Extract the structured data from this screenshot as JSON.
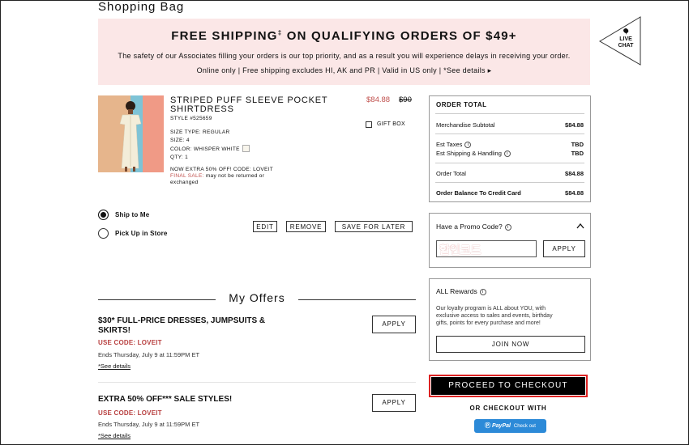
{
  "page": {
    "title": "Shopping Bag"
  },
  "banner": {
    "headline": "FREE SHIPPING",
    "mark": "‡",
    "headline_rest": " ON QUALIFYING ORDERS OF $49+",
    "line1": "The safety of our Associates filling your orders is our top priority, and as a result you will experience delays in receiving your order.",
    "line2": "Online only | Free shipping excludes HI, AK and PR | Valid in US only | *See details ▸"
  },
  "live_chat": {
    "line1": "LIVE",
    "line2": "CHAT"
  },
  "item": {
    "name_line1": "STRIPED PUFF SLEEVE POCKET",
    "name_line2": "SHIRTDRESS",
    "style": "STYLE #525659",
    "size_type": "SIZE TYPE: REGULAR",
    "size": "SIZE: 4",
    "color": "COLOR: WHISPER WHITE",
    "qty": "QTY: 1",
    "promo": "NOW EXTRA 50% OFF! CODE: LOVEIT",
    "final_sale": "FINAL SALE:",
    "final_sale_note": " may not be returned or",
    "final_sale_note2": "exchanged",
    "price_sale": "$84.88",
    "price_original": "$90",
    "gift_box": "GIFT BOX"
  },
  "delivery": {
    "ship_to_me": "Ship to Me",
    "pick_up": "Pick Up in Store"
  },
  "actions": {
    "edit": "EDIT",
    "remove": "REMOVE",
    "save_for_later": "SAVE FOR LATER"
  },
  "offers": {
    "title": "My Offers",
    "items": [
      {
        "title_line1": "$30* FULL-PRICE DRESSES, JUMPSUITS &",
        "title_line2": "SKIRTS!",
        "code": "USE CODE: LOVEIT",
        "ends": "Ends Thursday, July 9 at 11:59PM ET",
        "see": "*See details",
        "apply": "APPLY"
      },
      {
        "title_line1": "EXTRA 50% OFF*** SALE STYLES!",
        "title_line2": "",
        "code": "USE CODE: LOVEIT",
        "ends": "Ends Thursday, July 9 at 11:59PM ET",
        "see": "*See details",
        "apply": "APPLY"
      }
    ]
  },
  "order_total": {
    "title": "ORDER TOTAL",
    "merch_label": "Merchandise Subtotal",
    "merch_value": "$84.88",
    "tax_label": "Est Taxes",
    "tax_value": "TBD",
    "ship_label": "Est Shipping & Handling",
    "ship_value": "TBD",
    "total_label": "Order Total",
    "total_value": "$84.88",
    "balance_label": "Order Balance To Credit Card",
    "balance_value": "$84.88"
  },
  "promo": {
    "title": "Have a Promo Code?",
    "input_value": "할인코드",
    "apply": "APPLY"
  },
  "rewards": {
    "title": "ALL Rewards",
    "line1": "Our loyalty program is ALL about YOU, with",
    "line2": "exclusive access to sales and events, birthday",
    "line3": "gifts, points for every purchase and more!",
    "join": "JOIN NOW"
  },
  "checkout": {
    "proceed": "PROCEED TO CHECKOUT",
    "or_with": "OR CHECKOUT WITH",
    "paypal": "PayPal",
    "paypal_suffix": "Check out"
  },
  "colors": {
    "banner_bg": "#fbe7e7",
    "sale_red": "#c0504d",
    "paypal_blue": "#2c8ad8",
    "highlight_red": "#dd2222"
  },
  "icons": [
    "chat-bubble-icon",
    "info-icon",
    "chevron-up-icon"
  ]
}
